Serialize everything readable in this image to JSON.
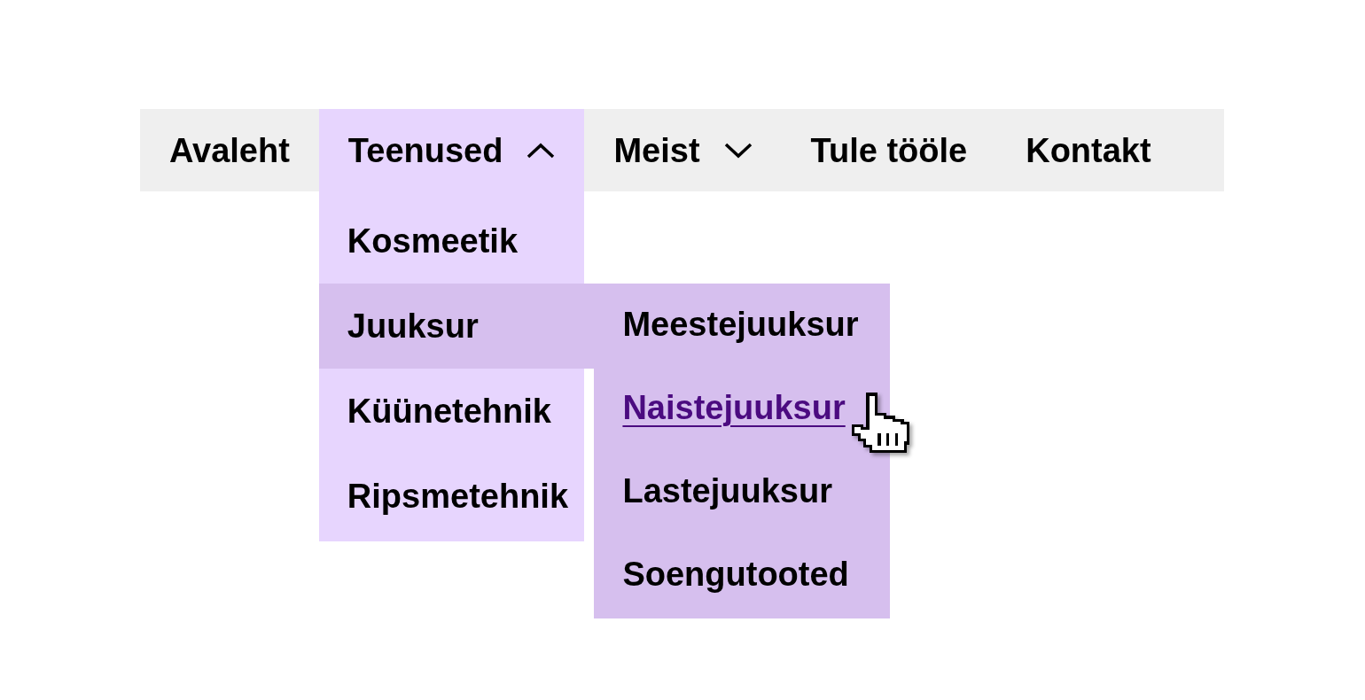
{
  "menu_bar": {
    "items": [
      {
        "label": "Avaleht",
        "kind": "link"
      },
      {
        "label": "Teenused",
        "kind": "dropdown",
        "expanded": true,
        "items": [
          {
            "label": "Kosmeetik",
            "selected": false
          },
          {
            "label": "Juuksur",
            "selected": true,
            "items": [
              {
                "label": "Meestejuuksur",
                "hovered": false
              },
              {
                "label": "Naistejuuksur",
                "hovered": true
              },
              {
                "label": "Lastejuuksur",
                "hovered": false
              },
              {
                "label": "Soengutooted",
                "hovered": false
              }
            ]
          },
          {
            "label": "Küünetehnik",
            "selected": false
          },
          {
            "label": "Ripsmetehnik",
            "selected": false
          }
        ]
      },
      {
        "label": "Meist",
        "kind": "dropdown",
        "expanded": false
      },
      {
        "label": "Tule tööle",
        "kind": "link"
      },
      {
        "label": "Kontakt",
        "kind": "link"
      }
    ]
  }
}
